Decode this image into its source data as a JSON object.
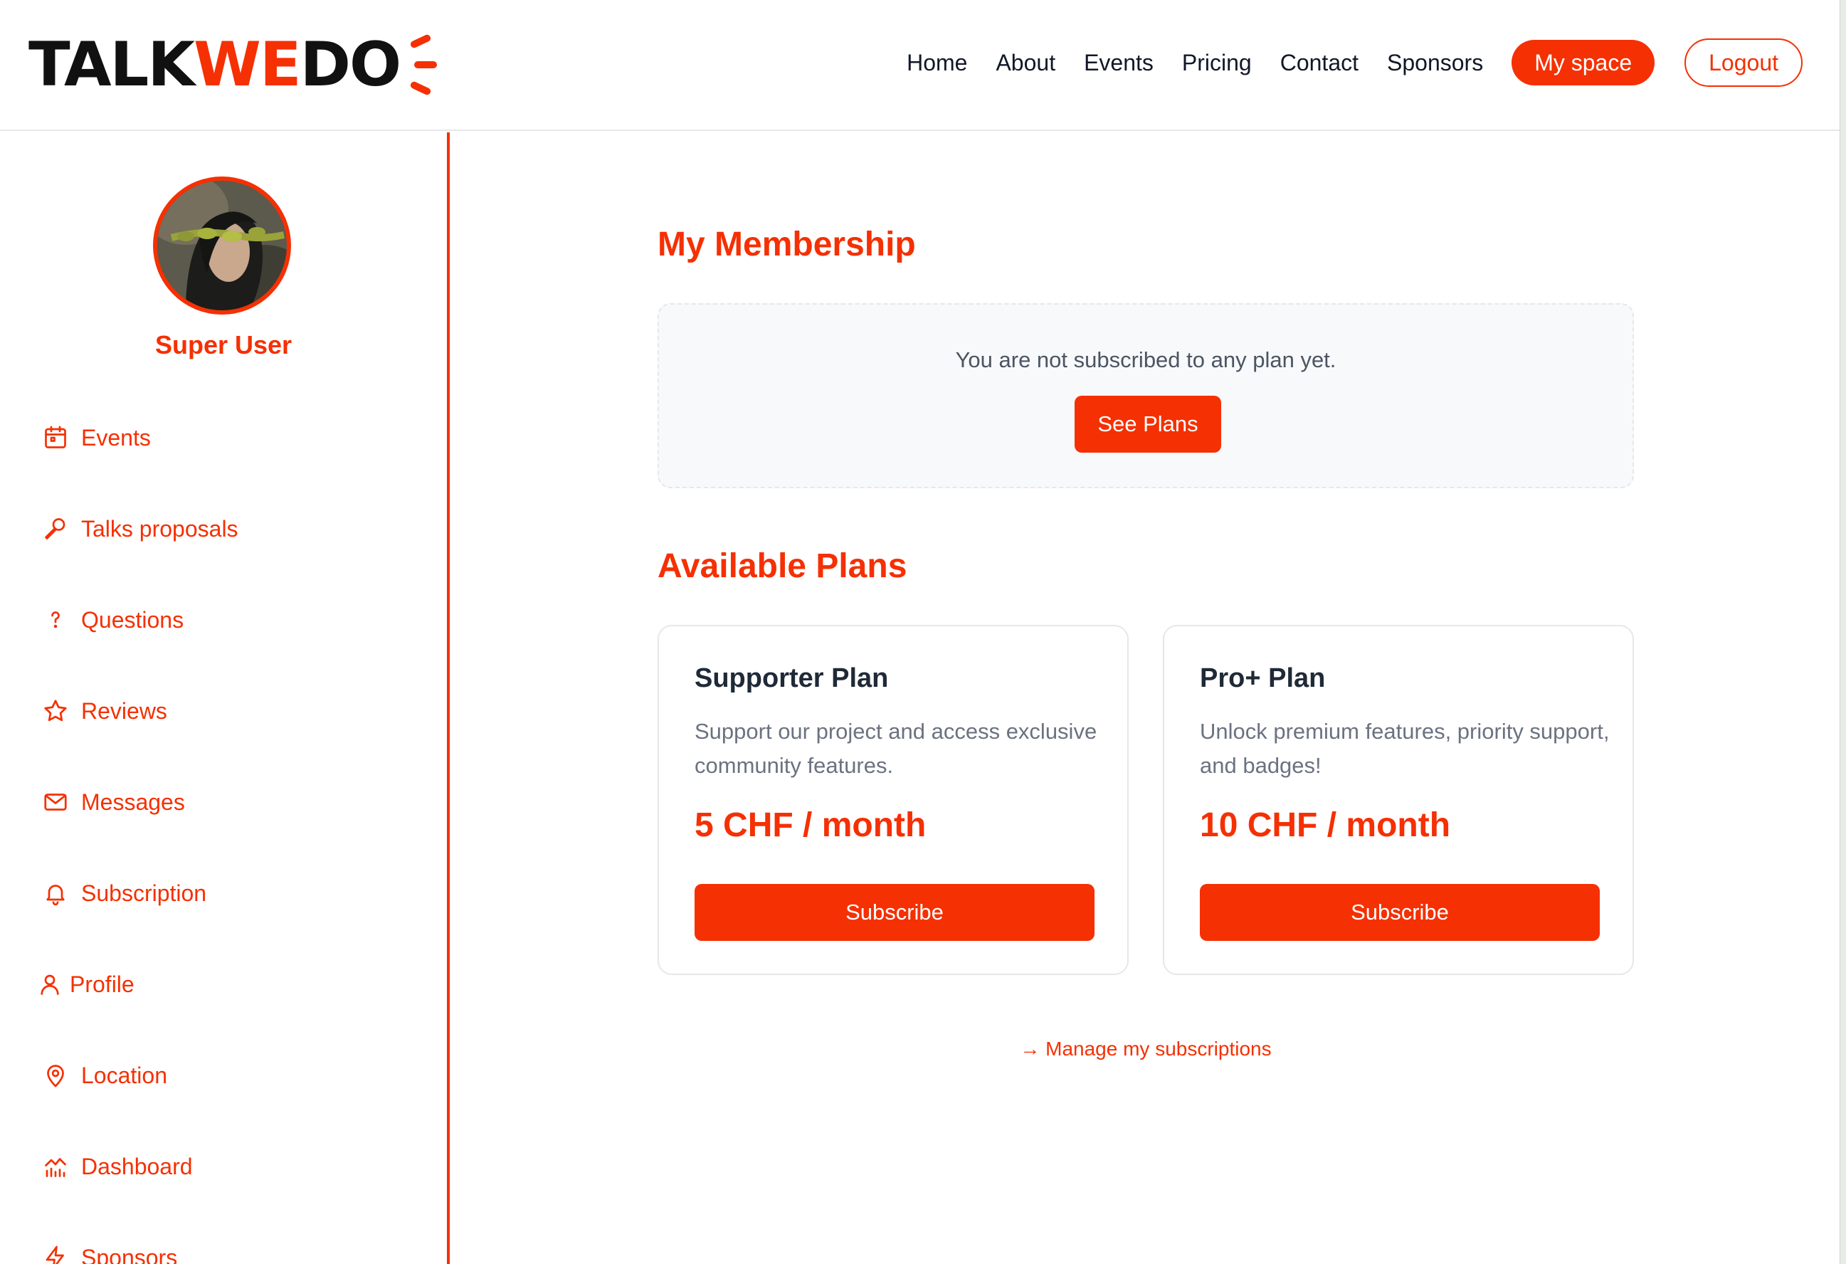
{
  "brand": {
    "logo_dark_1": "TALK",
    "logo_red": "WE",
    "logo_dark_2": "DO",
    "accent": "#f53003"
  },
  "nav": {
    "links": [
      "Home",
      "About",
      "Events",
      "Pricing",
      "Contact",
      "Sponsors"
    ],
    "my_space": "My space",
    "logout": "Logout"
  },
  "sidebar": {
    "user_name": "Super User",
    "items": [
      {
        "label": "Events",
        "icon": "calendar-icon"
      },
      {
        "label": "Talks proposals",
        "icon": "microphone-icon"
      },
      {
        "label": "Questions",
        "icon": "question-icon"
      },
      {
        "label": "Reviews",
        "icon": "star-icon"
      },
      {
        "label": "Messages",
        "icon": "mail-icon"
      },
      {
        "label": "Subscription",
        "icon": "bell-icon"
      },
      {
        "label": "Profile",
        "icon": "user-icon"
      },
      {
        "label": "Location",
        "icon": "map-pin-icon"
      },
      {
        "label": "Dashboard",
        "icon": "chart-icon"
      },
      {
        "label": "Sponsors",
        "icon": "bolt-icon"
      }
    ]
  },
  "main": {
    "membership_title": "My Membership",
    "membership_status": "You are not subscribed to any plan yet.",
    "see_plans": "See Plans",
    "plans_title": "Available Plans",
    "plans": [
      {
        "title": "Supporter Plan",
        "description": "Support our project and access exclusive community features.",
        "price": "5 CHF / month",
        "button": "Subscribe"
      },
      {
        "title": "Pro+ Plan",
        "description": "Unlock premium features, priority support, and badges!",
        "price": "10 CHF / month",
        "button": "Subscribe"
      }
    ],
    "manage_link": "→ Manage my subscriptions"
  }
}
